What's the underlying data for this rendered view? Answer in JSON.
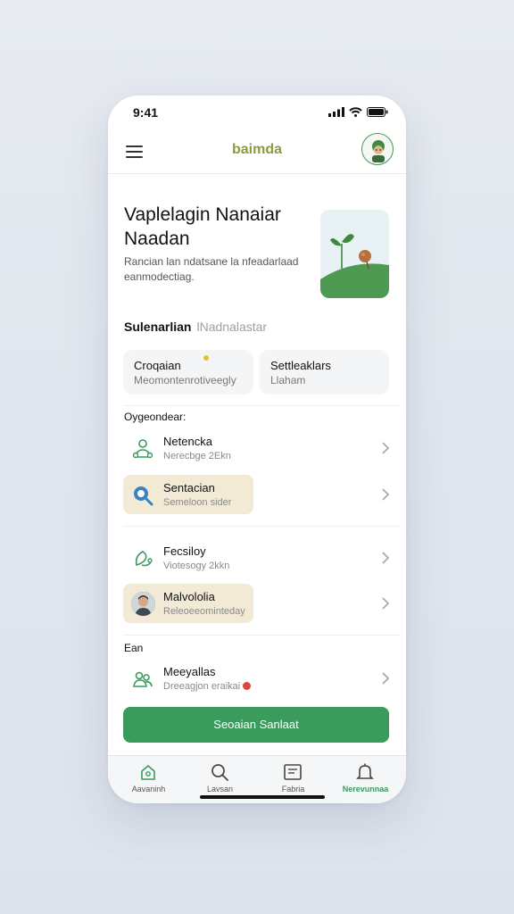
{
  "status": {
    "time": "9:41",
    "icons": [
      "signal-icon",
      "wifi-icon",
      "battery-icon"
    ]
  },
  "header": {
    "title": "baimda",
    "menu_icon": "menu-icon",
    "avatar_icon": "avatar"
  },
  "hero": {
    "title_line1": "Vaplelagin Nanaiar",
    "title_line2": "Naadan",
    "subtitle_line1": "Rancian lan ndatsane la nfeadarlaad",
    "subtitle_line2": "eanmodectiag."
  },
  "section": {
    "title": "Sulenarlian",
    "subtitle": "lNadnalastar"
  },
  "cards": [
    {
      "title": "Croqaian",
      "subtitle": "Meomontenrotiveegly"
    },
    {
      "title": "Settleaklars",
      "subtitle": "Llaham"
    }
  ],
  "groups": [
    {
      "label": "Oygeondear:",
      "items": [
        {
          "title": "Netencka",
          "subtitle": "Nerecbge 2Ekn",
          "icon": "user-network-icon",
          "highlight": false
        },
        {
          "title": "Sentacian",
          "subtitle": "Semeloon sider",
          "icon": "search-icon",
          "highlight": true
        }
      ]
    },
    {
      "label": "",
      "items": [
        {
          "title": "Fecsiloy",
          "subtitle": "Viotesogy 2kkn",
          "icon": "leaf-link-icon",
          "highlight": false
        },
        {
          "title": "Malvololia",
          "subtitle": "Releoeeominteday",
          "icon": "profile-photo",
          "highlight": true
        }
      ]
    },
    {
      "label": "Ean",
      "items": [
        {
          "title": "Meeyallas",
          "subtitle": "Dreeagjon eraikai",
          "icon": "group-icon",
          "highlight": false,
          "badge": "red-dot"
        }
      ]
    }
  ],
  "cta": {
    "label": "Seoaian Sanlaat"
  },
  "tabs": [
    {
      "label": "Aavaninh",
      "icon": "home-icon",
      "active": false
    },
    {
      "label": "Lavsan",
      "icon": "search-icon",
      "active": false
    },
    {
      "label": "Fabria",
      "icon": "document-icon",
      "active": false
    },
    {
      "label": "Nerevunnaa",
      "icon": "bell-icon",
      "active": true
    }
  ],
  "colors": {
    "accent": "#3a9b5c",
    "title_olive": "#8a9a3c",
    "highlight": "#f3ead5",
    "background": "#e4e8ef"
  }
}
